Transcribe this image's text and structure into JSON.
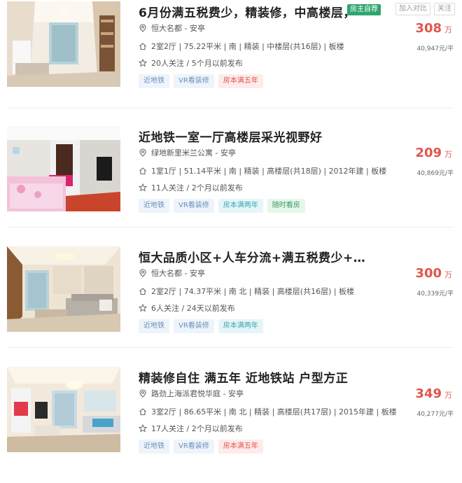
{
  "listings": [
    {
      "title": "6月份满五税费少，精装修，中高楼层，",
      "owner_badge": "房主自荐",
      "compare_label": "加入对比",
      "follow_label": "关注",
      "community": "恒大名都 - 安亭",
      "info": "2室2厅 | 75.22平米 | 南 | 精装 | 中楼层(共16层) | 板楼",
      "follow_info": "20人关注 / 5个月以前发布",
      "tags": [
        {
          "label": "近地铁",
          "type": "subway"
        },
        {
          "label": "VR看装修",
          "type": "vr"
        },
        {
          "label": "房本满五年",
          "type": "five"
        }
      ],
      "price": "308",
      "price_unit": "万",
      "unit_price": "40,947元/平"
    },
    {
      "title": "近地铁一室一厅高楼层采光视野好",
      "community": "绿地新里米兰公寓 - 安亭",
      "info": "1室1厅 | 51.14平米 | 南 | 精装 | 高楼层(共18层) | 2012年建 | 板楼",
      "follow_info": "11人关注 / 2个月以前发布",
      "tags": [
        {
          "label": "近地铁",
          "type": "subway"
        },
        {
          "label": "VR看装修",
          "type": "vr"
        },
        {
          "label": "房本满两年",
          "type": "two"
        },
        {
          "label": "随时看房",
          "type": "anytime"
        }
      ],
      "price": "209",
      "price_unit": "万",
      "unit_price": "40,869元/平"
    },
    {
      "title": "恒大品质小区+人车分流+满五税费少+…",
      "community": "恒大名都 - 安亭",
      "info": "2室2厅 | 74.37平米 | 南 北 | 精装 | 高楼层(共16层) | 板楼",
      "follow_info": "6人关注 / 24天以前发布",
      "tags": [
        {
          "label": "近地铁",
          "type": "subway"
        },
        {
          "label": "VR看装修",
          "type": "vr"
        },
        {
          "label": "房本满两年",
          "type": "two"
        }
      ],
      "price": "300",
      "price_unit": "万",
      "unit_price": "40,339元/平"
    },
    {
      "title": "精装修自住 满五年 近地铁站 户型方正",
      "community": "路劲上海派君悦华庭 - 安亭",
      "info": "3室2厅 | 86.65平米 | 南 北 | 精装 | 高楼层(共17层) | 2015年建 | 板楼",
      "follow_info": "17人关注 / 2个月以前发布",
      "tags": [
        {
          "label": "近地铁",
          "type": "subway"
        },
        {
          "label": "VR看装修",
          "type": "vr"
        },
        {
          "label": "房本满五年",
          "type": "five"
        }
      ],
      "price": "349",
      "price_unit": "万",
      "unit_price": "40,277元/平"
    }
  ]
}
